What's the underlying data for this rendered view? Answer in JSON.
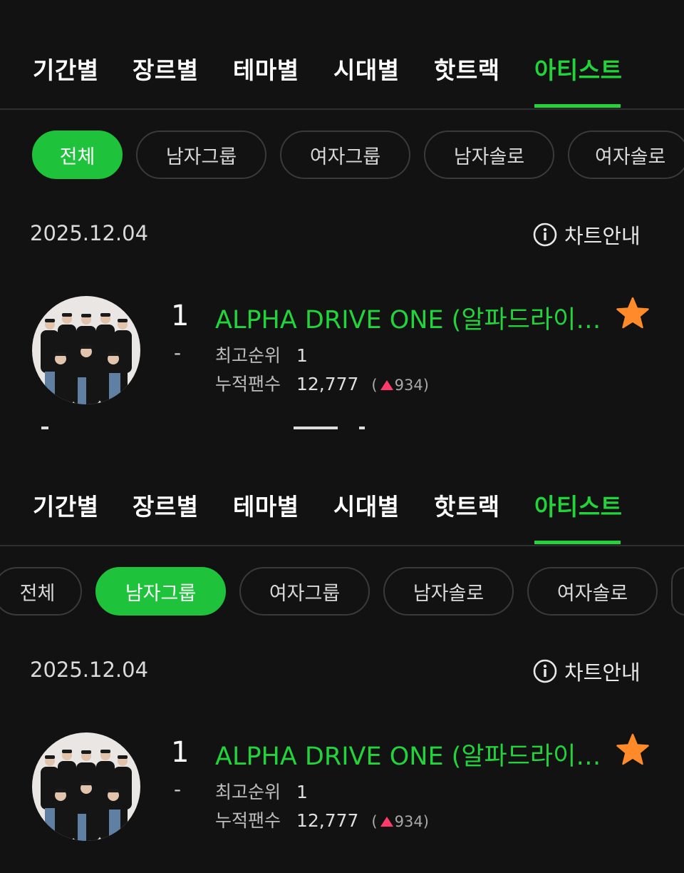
{
  "accent_color": "#22d33c",
  "chip_active_color": "#1fc33b",
  "star_color": "#ff8a2a",
  "up_triangle_color": "#ff3c69",
  "screens": [
    {
      "tabs": [
        "기간별",
        "장르별",
        "테마별",
        "시대별",
        "핫트랙",
        "아티스트"
      ],
      "active_tab": "아티스트",
      "chips": [
        "전체",
        "남자그룹",
        "여자그룹",
        "남자솔로",
        "여자솔로"
      ],
      "active_chip": "전체",
      "date": "2025.12.04",
      "chart_info_label": "차트안내",
      "entry": {
        "rank": "1",
        "rank_change": "-",
        "artist": "ALPHA DRIVE ONE (알파드라이…",
        "best_rank_label": "최고순위",
        "best_rank": "1",
        "fans_label": "누적팬수",
        "fans": "12,777",
        "fans_delta": "934",
        "favorite_icon": "star-icon",
        "open_paren": "(",
        "close_paren": ")"
      }
    },
    {
      "tabs": [
        "기간별",
        "장르별",
        "테마별",
        "시대별",
        "핫트랙",
        "아티스트"
      ],
      "active_tab": "아티스트",
      "chips": [
        "전체",
        "남자그룹",
        "여자그룹",
        "남자솔로",
        "여자솔로"
      ],
      "active_chip": "남자그룹",
      "date": "2025.12.04",
      "chart_info_label": "차트안내",
      "entry": {
        "rank": "1",
        "rank_change": "-",
        "artist": "ALPHA DRIVE ONE (알파드라이…",
        "best_rank_label": "최고순위",
        "best_rank": "1",
        "fans_label": "누적팬수",
        "fans": "12,777",
        "fans_delta": "934",
        "favorite_icon": "star-icon",
        "open_paren": "(",
        "close_paren": ")"
      }
    }
  ]
}
